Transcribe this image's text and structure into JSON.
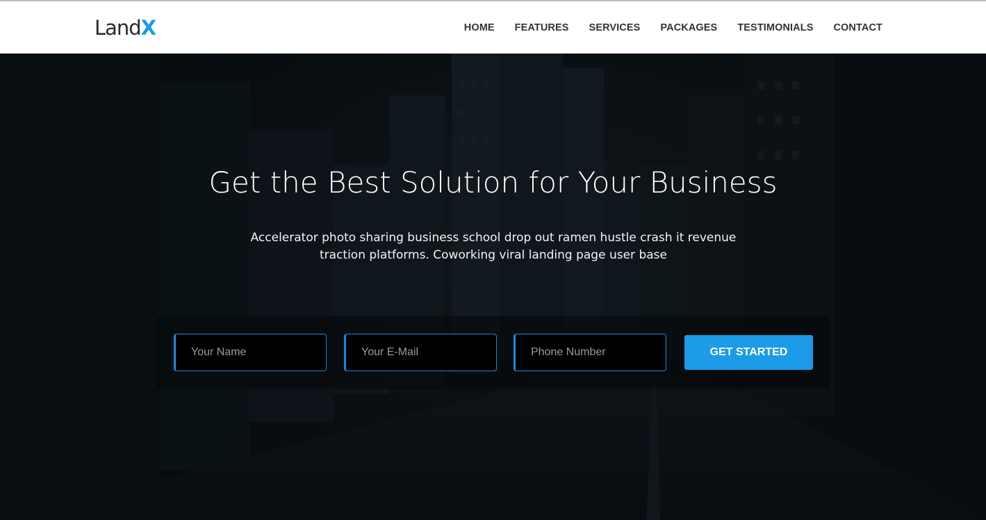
{
  "brand": {
    "name_main": "Land",
    "name_accent": "X",
    "accent_color": "#1e9be3"
  },
  "nav": {
    "items": [
      {
        "label": "HOME"
      },
      {
        "label": "FEATURES"
      },
      {
        "label": "SERVICES"
      },
      {
        "label": "PACKAGES"
      },
      {
        "label": "TESTIMONIALS"
      },
      {
        "label": "CONTACT"
      }
    ]
  },
  "hero": {
    "title": "Get the Best Solution for Your Business",
    "subtitle": "Accelerator photo sharing business school drop out ramen hustle crash it revenue traction platforms. Coworking viral landing page user base"
  },
  "form": {
    "name_placeholder": "Your Name",
    "email_placeholder": "Your E-Mail",
    "phone_placeholder": "Phone Number",
    "submit_label": "GET STARTED",
    "button_color": "#1c9be6"
  }
}
